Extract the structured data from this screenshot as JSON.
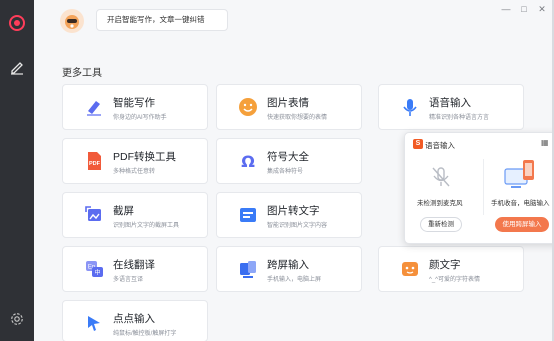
{
  "header": {
    "assistant_prompt": "开启智能写作，文章一键纠错"
  },
  "window_controls": {
    "minimize": "—",
    "maximize": "□",
    "close": "✕"
  },
  "section": {
    "title": "更多工具"
  },
  "tools": [
    {
      "title": "智能写作",
      "subtitle": "你身边的AI写作助手",
      "icon": "pen-icon",
      "color": "#5b6cf0"
    },
    {
      "title": "图片表情",
      "subtitle": "快速获取你想要的表情",
      "icon": "smiley-icon",
      "color": "#f5a03b"
    },
    {
      "title": "语音输入",
      "subtitle": "精准识别各种语言方言",
      "icon": "microphone-icon",
      "color": "#3a7bf7"
    },
    {
      "title": "PDF转换工具",
      "subtitle": "多种格式任意转",
      "icon": "pdf-icon",
      "color": "#f15a3a"
    },
    {
      "title": "符号大全",
      "subtitle": "集成各种符号",
      "icon": "omega-icon",
      "color": "#5b6cf0"
    },
    {
      "title": "截屏",
      "subtitle": "识别图片文字的截屏工具",
      "icon": "screenshot-icon",
      "color": "#5b6cf0"
    },
    {
      "title": "图片转文字",
      "subtitle": "智能识别图片文字内容",
      "icon": "image-to-text-icon",
      "color": "#3a7bf7"
    },
    {
      "title": "在线翻译",
      "subtitle": "多语言互译",
      "icon": "translate-icon",
      "color": "#5b6cf0"
    },
    {
      "title": "跨屏输入",
      "subtitle": "手机输入，电脑上屏",
      "icon": "cross-screen-icon",
      "color": "#3a6ef0"
    },
    {
      "title": "颜文字",
      "subtitle": "^_^可爱的字符表情",
      "icon": "emoticon-icon",
      "color": "#f5903b"
    },
    {
      "title": "点点输入",
      "subtitle": "纯鼠标/触控板/触屏打字",
      "icon": "cursor-icon",
      "color": "#3a7bf7"
    }
  ],
  "voice_popup": {
    "title": "语音输入",
    "no_mic_label": "未检测到麦克风",
    "phone_label": "手机收音，电脑输入",
    "recheck_button": "重新检测",
    "use_cross_screen_button": "使用跨屏输入"
  }
}
